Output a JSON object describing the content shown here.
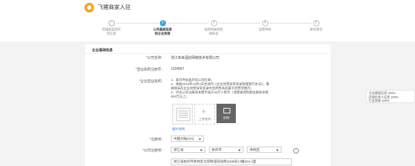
{
  "header": {
    "brand": "飞猪商家入驻"
  },
  "steps": [
    {
      "num": "✓",
      "label": "店铺类型检控\n资信息",
      "state": "done"
    },
    {
      "num": "2",
      "label": "公司基础信息\n和企业资质",
      "state": "active"
    },
    {
      "num": "3",
      "label": "品牌资质和后\n辅命名",
      "state": "todo"
    },
    {
      "num": "4",
      "label": "运营审核",
      "state": "todo"
    },
    {
      "num": "5",
      "label": "账号激活",
      "state": "todo"
    }
  ],
  "card": {
    "title": "企业基础信息"
  },
  "form": {
    "company_name_label": "公司名称：",
    "company_name": "浙江未来酒店网络技术有限公司",
    "license_label": "营业执照注册号：",
    "license_no": "1234567",
    "scope_label": "企业营业执照：",
    "scope_lines": [
      "1、复印件加盖开房公司红章；",
      "2、根据2014年10月1日生效的《企业经营异常名录管理暂行办法》，需",
      "确保未在企业经营异常名录中且所售商品属于经营范围内；",
      "3、开业公司注册资本需不低于30万人民币（或需收得现银注册资本需",
      "500万以上）"
    ],
    "upload_label": "上传附件",
    "sample_label": "示例",
    "img_note": "图片规则",
    "reg_place_label": "注册地：",
    "reg_place": "中国大陆(CN)",
    "reg_addr_label": "公司注册地：",
    "province": "浙江省",
    "city": "杭州市",
    "district": "余杭区",
    "address": "浙江省杭州市余杭区仓前街道向往街1008号17幢201-1室"
  },
  "side": {
    "line1": "企业基础信息 100%",
    "line2": "店铺负责人信息 100%",
    "line3": "行业资质 100%"
  }
}
